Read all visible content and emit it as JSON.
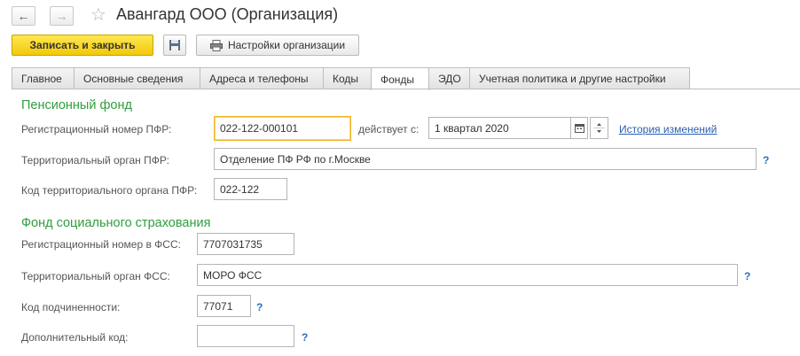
{
  "window": {
    "title": "Авангард ООО (Организация)"
  },
  "toolbar": {
    "save_close_label": "Записать и закрыть",
    "settings_label": "Настройки организации"
  },
  "tabs": [
    {
      "label": "Главное"
    },
    {
      "label": "Основные сведения"
    },
    {
      "label": "Адреса и телефоны"
    },
    {
      "label": "Коды"
    },
    {
      "label": "Фонды",
      "active": true
    },
    {
      "label": "ЭДО"
    },
    {
      "label": "Учетная политика и другие настройки"
    }
  ],
  "pfr": {
    "section_title": "Пенсионный фонд",
    "reg_label": "Регистрационный номер ПФР:",
    "reg_value": "022-122-000101",
    "valid_from_label": "действует с:",
    "valid_from_value": "1 квартал 2020",
    "history_link": "История изменений",
    "org_label": "Территориальный орган ПФР:",
    "org_value": "Отделение ПФ РФ по г.Москве",
    "org_code_label": "Код территориального органа ПФР:",
    "org_code_value": "022-122"
  },
  "fss": {
    "section_title": "Фонд социального страхования",
    "reg_label": "Регистрационный номер в ФСС:",
    "reg_value": "7707031735",
    "org_label": "Территориальный орган ФСС:",
    "org_value": "МОРО ФСС",
    "sub_code_label": "Код подчиненности:",
    "sub_code_value": "77071",
    "extra_code_label": "Дополнительный код:",
    "extra_code_value": ""
  },
  "help_mark": "?",
  "icons": {
    "back": "arrow-left-icon",
    "forward": "arrow-right-icon",
    "favorite": "star-icon",
    "save": "floppy-disk-icon",
    "settings": "printer-icon",
    "calendar": "calendar-icon",
    "spin": "spin-updown-icon"
  }
}
